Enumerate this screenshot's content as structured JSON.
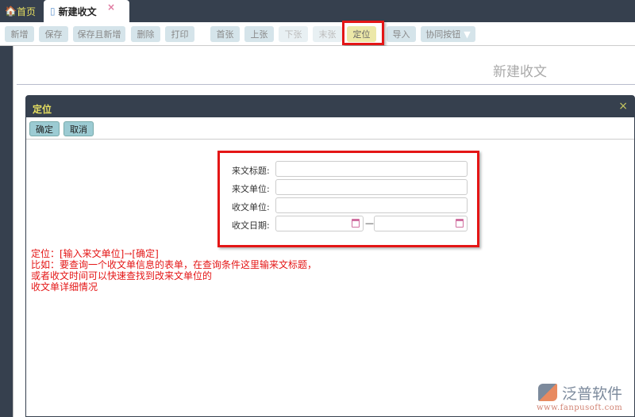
{
  "tabs": [
    {
      "label": "首页",
      "icon": "home-icon"
    },
    {
      "label": "新建收文",
      "icon": "document-icon",
      "close": "×"
    }
  ],
  "toolbar": [
    "新增",
    "保存",
    "保存且新增",
    "删除",
    "打印",
    "首张",
    "上张",
    "下张",
    "末张",
    "定位",
    "导入",
    "协同按钮"
  ],
  "page_title": "新建收文",
  "dialog": {
    "title": "定位",
    "close": "×",
    "ok": "确定",
    "cancel": "取消",
    "fields": [
      {
        "label": "来文标题:"
      },
      {
        "label": "来文单位:"
      },
      {
        "label": "收文单位:"
      },
      {
        "label": "收文日期:"
      }
    ],
    "date_sep": "—"
  },
  "note": [
    "定位：[输入来文单位]→[确定]",
    "比如：要查询一个收文单信息的表单，在查询条件这里输来文标题，",
    "或者收文时间可以快速查找到改来文单位的",
    "收文单详细情况"
  ],
  "logo": {
    "name": "泛普软件",
    "url": "www.fanpusoft.com"
  }
}
